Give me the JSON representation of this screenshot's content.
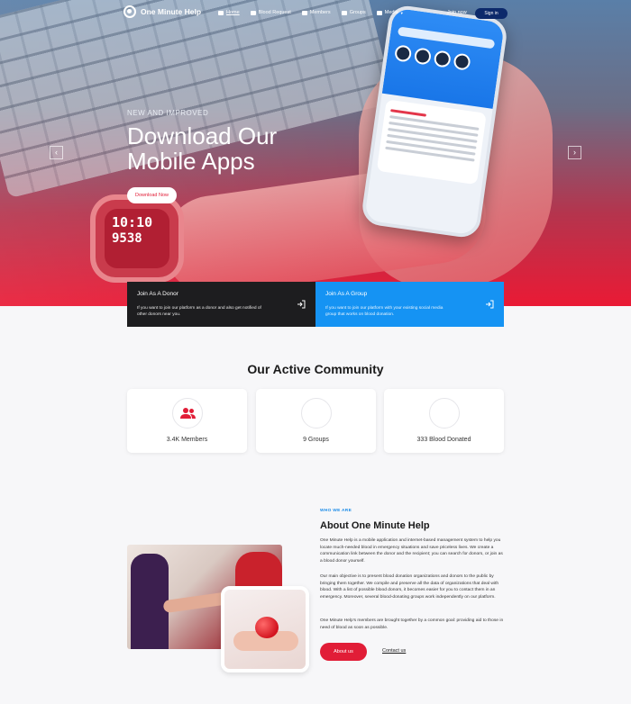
{
  "nav": {
    "logo_text": "One Minute Help",
    "links": [
      {
        "label": "Home"
      },
      {
        "label": "Blood Request"
      },
      {
        "label": "Members"
      },
      {
        "label": "Groups"
      },
      {
        "label": "Media"
      }
    ],
    "join_label": "Join now",
    "signin_label": "Sign in"
  },
  "hero": {
    "label": "NEW AND IMPROVED",
    "title": "Download Our Mobile Apps",
    "button_label": "Download Now",
    "watch_time": "10:10",
    "watch_value": "9538",
    "prev_arrow": "‹",
    "next_arrow": "›"
  },
  "join": {
    "donor": {
      "title": "Join As A Donor",
      "text": "If you want to join our platform as a donor and also get notified of other donors near you.",
      "icon": "sign-in-icon"
    },
    "group": {
      "title": "Join As A Group",
      "text": "If you want to join our platform with your existing social media group that works on blood donation.",
      "icon": "sign-in-icon"
    }
  },
  "community": {
    "title": "Our Active Community",
    "stats": [
      {
        "label": "3.4K Members",
        "icon": "people-icon"
      },
      {
        "label": "9 Groups",
        "icon": "groups-icon"
      },
      {
        "label": "333 Blood Donated",
        "icon": "blood-drop-icon"
      }
    ]
  },
  "about": {
    "tag": "WHO WE ARE",
    "title": "About One Minute Help",
    "paragraphs": [
      "One Minute Help is a mobile application and internet-based management system to help you locate much-needed blood in emergency situations and save priceless lives. We create a communication link between the donor and the recipient; you can search for donors, or join as a blood donor yourself.",
      "Our main objective is to present blood donation organizations and donors to the public by bringing them together. We compile and preserve all the data of organizations that deal with blood. With a list of possible blood donors, it becomes easier for you to contact them in an emergency. Moreover, several blood-donating groups work independently on our platform.",
      "One Minute Help's members are brought together by a common goal: providing aid to those in need of blood as soon as possible."
    ],
    "button_label": "About us",
    "contact_label": "Contact us"
  },
  "colors": {
    "brand_red": "#e11d37",
    "brand_blue": "#1593f3",
    "navy": "#0d2a6b"
  }
}
